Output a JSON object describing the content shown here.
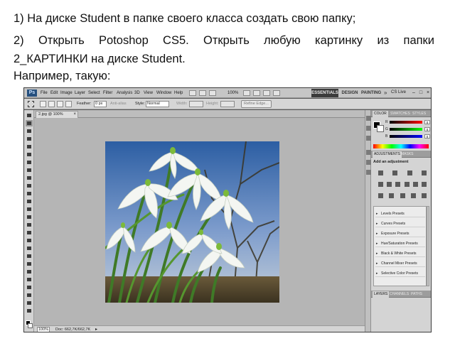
{
  "instructions": {
    "line1": "1)  На диске Student в папке своего класса создать свою папку;",
    "line2": "2)  Открыть  Potoshop  CS5.  Открыть  любую  картинку  из  папки",
    "line3": "2_КАРТИНКИ на диске Student.",
    "line4": "Например, такую:"
  },
  "photoshop": {
    "menu": [
      "File",
      "Edit",
      "Image",
      "Layer",
      "Select",
      "Filter",
      "Analysis",
      "3D",
      "View",
      "Window",
      "Help"
    ],
    "zoom_select": "100%",
    "workspaces": {
      "essentials": "ESSENTIALS",
      "design": "DESIGN",
      "painting": "PAINTING",
      "more": "»"
    },
    "cs_live": "CS Live",
    "options": {
      "feather_label": "Feather:",
      "feather_value": "0 px",
      "antialias_label": "Anti-alias",
      "style_label": "Style:",
      "style_value": "Normal",
      "width_label": "Width:",
      "height_label": "Height:",
      "refine_edge": "Refine Edge..."
    },
    "document_tab": "2.jpg @ 100% (RGB/8#)",
    "status": {
      "zoom": "100%",
      "doc": "Doc: 662,7K/662,7K"
    },
    "color_panel": {
      "tabs": [
        "COLOR",
        "SWATCHES",
        "STYLES"
      ],
      "channels": [
        {
          "name": "R",
          "value": "0"
        },
        {
          "name": "G",
          "value": "0"
        },
        {
          "name": "B",
          "value": "0"
        }
      ]
    },
    "adjustments_panel": {
      "tabs": [
        "ADJUSTMENTS",
        "MASKS"
      ],
      "title": "Add an adjustment",
      "presets": [
        "Levels Presets",
        "Curves Presets",
        "Exposure Presets",
        "Hue/Saturation Presets",
        "Black & White Presets",
        "Channel Mixer Presets",
        "Selective Color Presets"
      ]
    },
    "layers_panel": {
      "tabs": [
        "LAYERS",
        "CHANNELS",
        "PATHS"
      ]
    },
    "colors": {
      "ui_dark": "#3b3b3b",
      "panel": "#d4d4d4",
      "canvas": "#b5b5b5",
      "ps_blue": "#26507e"
    }
  }
}
